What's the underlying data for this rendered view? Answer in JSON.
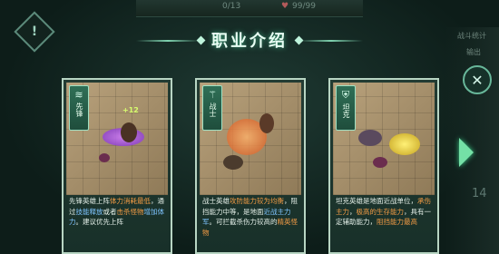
{
  "background": {
    "stat_1": "0/13",
    "stat_2": "99/99",
    "right_label_1": "战斗统计",
    "right_label_2": "输出",
    "right_number": "14"
  },
  "header": {
    "title": "职业介绍"
  },
  "cards": [
    {
      "role_label": "先锋",
      "icon": "vanguard-icon",
      "floating_text": "+12",
      "desc_parts": [
        {
          "t": "先锋英雄上阵",
          "c": ""
        },
        {
          "t": "体力消耗最低",
          "c": "hl"
        },
        {
          "t": "，通过",
          "c": ""
        },
        {
          "t": "技能释放",
          "c": "bl"
        },
        {
          "t": "或者",
          "c": ""
        },
        {
          "t": "击杀怪物",
          "c": "hl"
        },
        {
          "t": "增加体力",
          "c": "bl"
        },
        {
          "t": "。建议优先上阵",
          "c": ""
        }
      ]
    },
    {
      "role_label": "战士",
      "icon": "warrior-icon",
      "desc_parts": [
        {
          "t": "战士英雄",
          "c": ""
        },
        {
          "t": "攻防能力较为均衡",
          "c": "hl"
        },
        {
          "t": "，阻挡能力中等，是地面",
          "c": ""
        },
        {
          "t": "近战主力军",
          "c": "bl"
        },
        {
          "t": "。可拦截杀伤力较高的",
          "c": ""
        },
        {
          "t": "精英怪物",
          "c": "hl"
        }
      ]
    },
    {
      "role_label": "坦克",
      "icon": "tank-icon",
      "desc_parts": [
        {
          "t": "坦克英雄是地面近战单位，",
          "c": ""
        },
        {
          "t": "承伤主力",
          "c": "hl"
        },
        {
          "t": "，",
          "c": ""
        },
        {
          "t": "极高的生存能力",
          "c": "hl"
        },
        {
          "t": "，具有一定辅助能力，",
          "c": ""
        },
        {
          "t": "阻挡能力最高",
          "c": "hl"
        }
      ]
    }
  ],
  "colors": {
    "highlight_orange": "#f29b45",
    "highlight_blue": "#7fc4ff",
    "accent_green": "#74e0a6"
  }
}
